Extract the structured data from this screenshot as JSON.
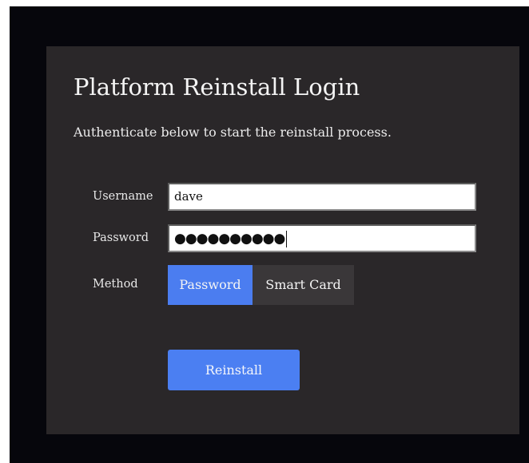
{
  "login": {
    "title": "Platform Reinstall Login",
    "subtitle": "Authenticate below to start the reinstall process.",
    "username_label": "Username",
    "username_value": "dave",
    "password_label": "Password",
    "password_mask": "●●●●●●●●●●",
    "method_label": "Method",
    "methods": [
      {
        "label": "Password",
        "selected": true
      },
      {
        "label": "Smart Card",
        "selected": false
      }
    ],
    "submit_label": "Reinstall"
  },
  "colors": {
    "accent": "#4b7df0",
    "panel": "#2a2729",
    "backdrop": "#06060c"
  }
}
